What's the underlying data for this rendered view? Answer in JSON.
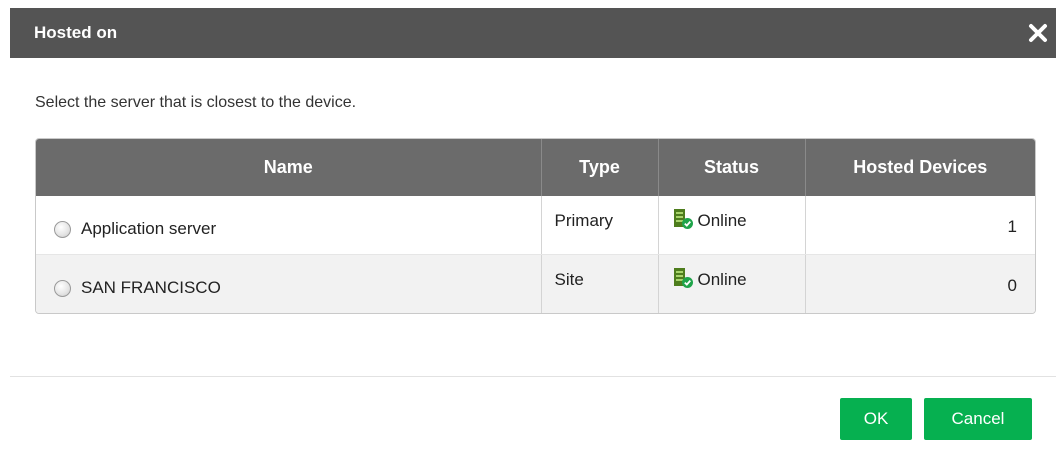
{
  "dialog": {
    "title": "Hosted on",
    "close_icon": "close-icon",
    "instruction": "Select the server that is closest to the device."
  },
  "table": {
    "columns": [
      "Name",
      "Type",
      "Status",
      "Hosted Devices"
    ],
    "rows": [
      {
        "name": "Application server",
        "type": "Primary",
        "status": "Online",
        "hosted_devices": "1",
        "selected": false
      },
      {
        "name": "SAN FRANCISCO",
        "type": "Site",
        "status": "Online",
        "hosted_devices": "0",
        "selected": false
      }
    ]
  },
  "buttons": {
    "ok": "OK",
    "cancel": "Cancel"
  },
  "colors": {
    "title_bar": "#545454",
    "table_header": "#6b6b6b",
    "accent_green": "#06b050"
  },
  "icons": {
    "status_online": "server-online-icon",
    "radio": "radio-button"
  }
}
